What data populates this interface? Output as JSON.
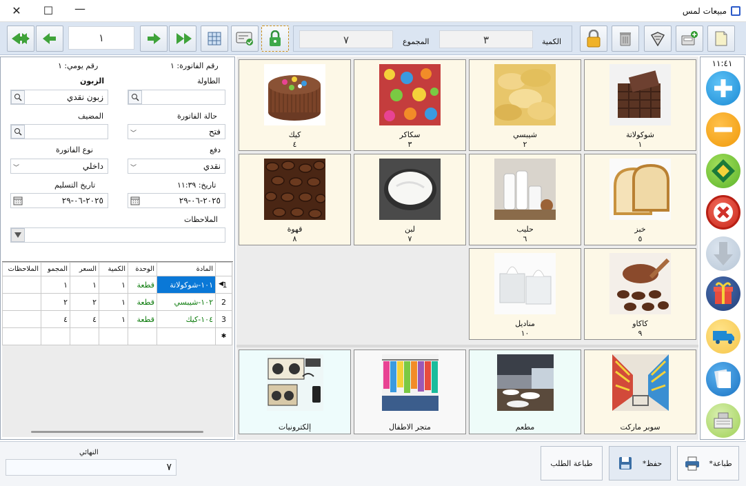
{
  "title": "مبيعات لمس",
  "toolbar": {
    "page_value": "١",
    "qty_label": "الكمية",
    "qty_value": "٣",
    "total_label": "المجموع",
    "total_value": "٧"
  },
  "invoice": {
    "invoice_no": "رقم الفاتورة: ١",
    "daily_no": "رقم يومي: ١",
    "table_label": "الطاولة",
    "table_value": "",
    "customer_label": "الزبون",
    "customer_value": "زبون نقدي",
    "host_label": "المضيف",
    "host_value": "",
    "status_label": "حالة الفاتورة",
    "status_value": "فتح",
    "payment_label": "دفع",
    "payment_value": "نقدي",
    "type_label": "نوع الفاتورة",
    "type_value": "داخلي",
    "date_label": "تاريخ: ١١:٣٩",
    "date_value": "٢٠٢٥-٠٦-٢٩",
    "delivery_label": "تاريخ التسليم",
    "delivery_value": "٢٠٢٥-٠٦-٢٩",
    "notes_label": "الملاحظات",
    "notes_value": ""
  },
  "grid": {
    "headers": [
      "المادة",
      "الوحدة",
      "الكمية",
      "السعر",
      "المجمو",
      "الملاحظات"
    ],
    "rows": [
      {
        "num": "1",
        "item": "١٠١-شوكولاتة",
        "unit": "قطعة",
        "qty": "١",
        "price": "١",
        "total": "١",
        "notes": ""
      },
      {
        "num": "2",
        "item": "١٠٢-شيبسي",
        "unit": "قطعة",
        "qty": "١",
        "price": "٢",
        "total": "٢",
        "notes": ""
      },
      {
        "num": "3",
        "item": "١٠٤-كيك",
        "unit": "قطعة",
        "qty": "١",
        "price": "٤",
        "total": "٤",
        "notes": ""
      }
    ]
  },
  "products": [
    {
      "name": "شوكولاتة",
      "price": "١"
    },
    {
      "name": "شيبسي",
      "price": "٢"
    },
    {
      "name": "سكاكر",
      "price": "٣"
    },
    {
      "name": "كيك",
      "price": "٤"
    },
    {
      "name": "خبز",
      "price": "٥"
    },
    {
      "name": "حليب",
      "price": "٦"
    },
    {
      "name": "لبن",
      "price": "٧"
    },
    {
      "name": "قهوة",
      "price": "٨"
    },
    {
      "name": "كاكاو",
      "price": "٩"
    },
    {
      "name": "مناديل",
      "price": "١٠"
    }
  ],
  "categories": [
    {
      "name": "سوبر ماركت"
    },
    {
      "name": "مطعم"
    },
    {
      "name": "متجر الاطفال"
    },
    {
      "name": "إلكترونيات"
    }
  ],
  "clock": "١١:٤١",
  "bottom": {
    "final_label": "النهائي",
    "final_value": "٧",
    "print_label": "طباعة*",
    "save_label": "حفظ*",
    "print_order_label": "طباعة الطلب"
  },
  "colors": {
    "toolbar_bg": "#dbe5f2",
    "tile_bg": "#fdf8e7",
    "category_selected_bg": "#eefcf9",
    "selected_row": "#0a78d7",
    "unit_text": "#0b7a0b"
  }
}
